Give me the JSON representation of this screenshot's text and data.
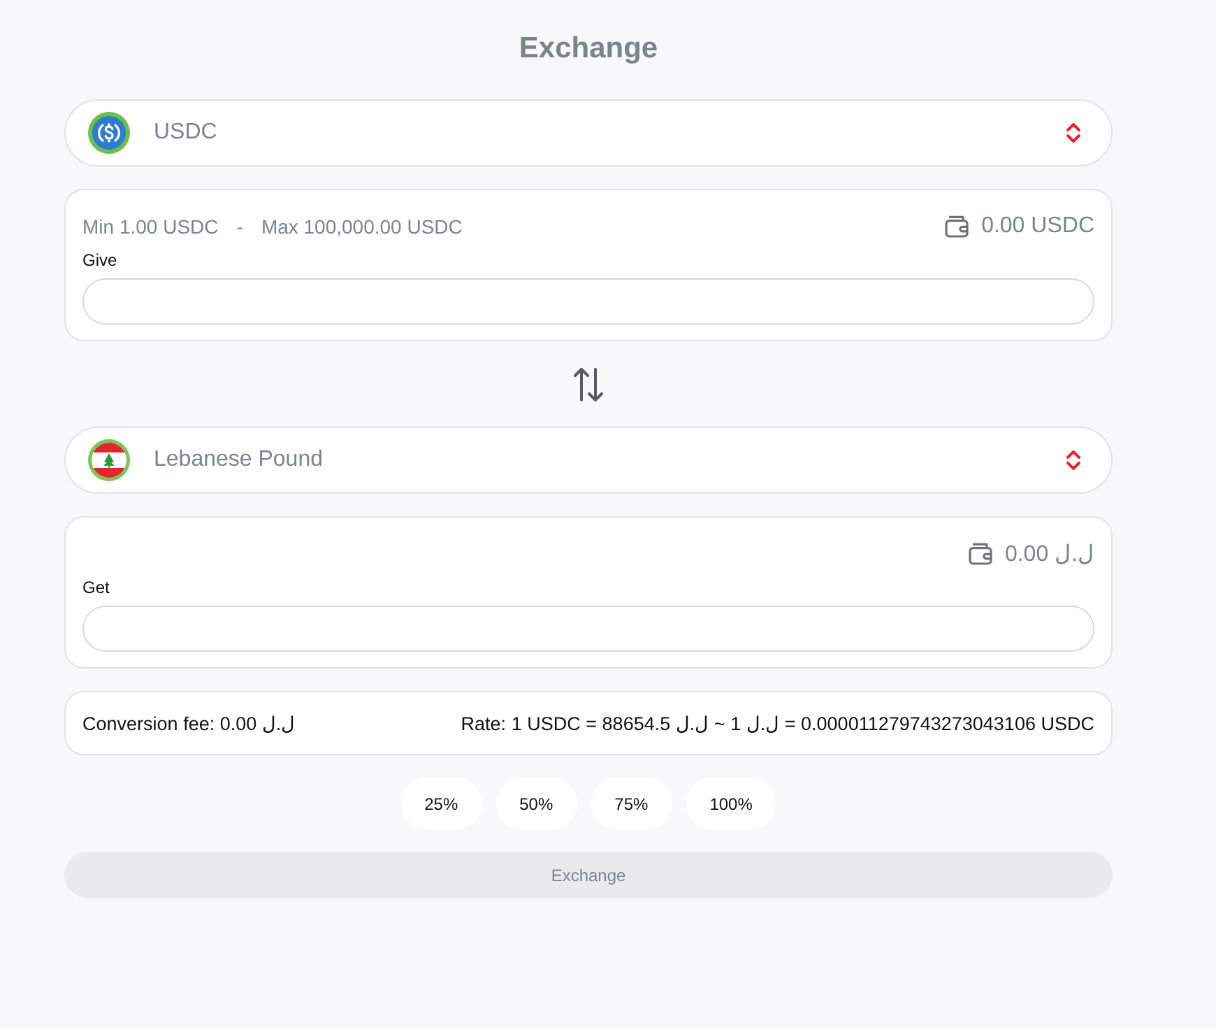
{
  "title": "Exchange",
  "give": {
    "currency": {
      "kind": "usdc",
      "name": "USDC"
    },
    "min": "Min 1.00 USDC",
    "separator": "-",
    "max": "Max 100,000.00 USDC",
    "balance": "0.00 USDC",
    "label": "Give"
  },
  "get": {
    "currency": {
      "kind": "lebanon_flag",
      "name": "Lebanese Pound"
    },
    "balance": "0.00 ل.ل",
    "label": "Get"
  },
  "info": {
    "fee": "Conversion fee: 0.00 ل.ل",
    "rate": "Rate: 1 USDC = 88654.5 ل.ل ~ 1 ل.ل = 0.000011279743273043106 USDC"
  },
  "percent_buttons": [
    "25%",
    "50%",
    "75%",
    "100%"
  ],
  "submit": {
    "label": "Exchange",
    "disabled": true
  }
}
